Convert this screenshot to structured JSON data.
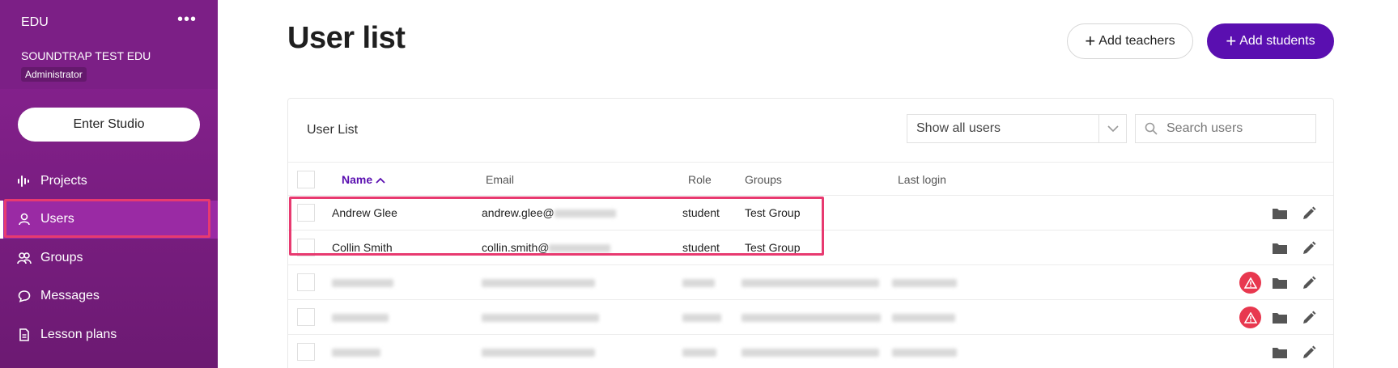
{
  "sidebar": {
    "product": "EDU",
    "org_name": "SOUNDTRAP TEST EDU",
    "role": "Administrator",
    "enter_studio": "Enter Studio",
    "more": "•••",
    "items": [
      {
        "label": "Projects"
      },
      {
        "label": "Users"
      },
      {
        "label": "Groups"
      },
      {
        "label": "Messages"
      },
      {
        "label": "Lesson plans"
      }
    ]
  },
  "header": {
    "title": "User list",
    "add_teachers": "Add teachers",
    "add_students": "Add students"
  },
  "card": {
    "title": "User List",
    "filter_value": "Show all users",
    "search_placeholder": "Search users"
  },
  "table": {
    "columns": {
      "name": "Name",
      "email": "Email",
      "role": "Role",
      "groups": "Groups",
      "last_login": "Last login"
    },
    "rows": [
      {
        "name": "Andrew Glee",
        "email": "andrew.glee@",
        "role": "student",
        "groups": "Test Group"
      },
      {
        "name": "Collin Smith",
        "email": "collin.smith@",
        "role": "student",
        "groups": "Test Group"
      }
    ]
  },
  "colors": {
    "sidebar": "#7c1f86",
    "accent": "#5a0fb0",
    "highlight": "#e83a70",
    "warning": "#e8384f"
  }
}
